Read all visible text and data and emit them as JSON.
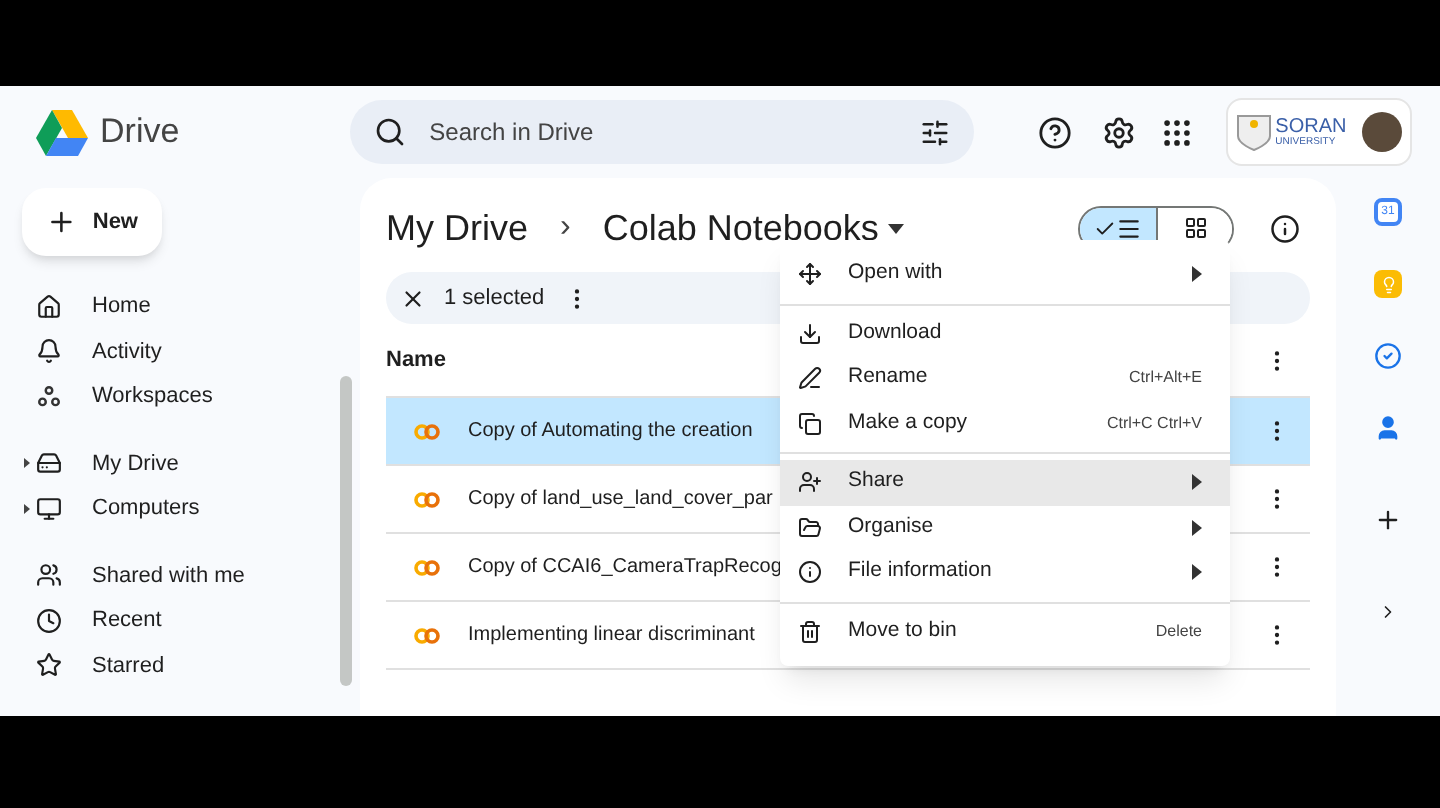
{
  "app": {
    "name": "Drive"
  },
  "search": {
    "placeholder": "Search in Drive"
  },
  "account": {
    "org_line1": "SORAN",
    "org_line2": "UNIVERSITY"
  },
  "new_button": {
    "label": "New"
  },
  "sidebar": {
    "items": [
      {
        "label": "Home",
        "expandable": false
      },
      {
        "label": "Activity",
        "expandable": false
      },
      {
        "label": "Workspaces",
        "expandable": false
      },
      {
        "label": "My Drive",
        "expandable": true
      },
      {
        "label": "Computers",
        "expandable": true
      },
      {
        "label": "Shared with me",
        "expandable": false
      },
      {
        "label": "Recent",
        "expandable": false
      },
      {
        "label": "Starred",
        "expandable": false
      }
    ]
  },
  "breadcrumb": {
    "root": "My Drive",
    "separator": "›",
    "current": "Colab Notebooks"
  },
  "view_toggle": {
    "list_selected": true
  },
  "selection_bar": {
    "count": "1 selected"
  },
  "table": {
    "columns": [
      "Name"
    ],
    "rows": [
      {
        "name": "Copy of Automating the creation",
        "selected": true
      },
      {
        "name": "Copy of land_use_land_cover_par",
        "selected": false
      },
      {
        "name": "Copy of CCAI6_CameraTrapRecog",
        "selected": false
      },
      {
        "name": "Implementing linear discriminant",
        "selected": false
      }
    ]
  },
  "context_menu": {
    "sections": [
      [
        {
          "label": "Open with",
          "submenu": true,
          "highlighted": false
        }
      ],
      [
        {
          "label": "Download",
          "submenu": false,
          "highlighted": false
        },
        {
          "label": "Rename",
          "shortcut": "Ctrl+Alt+E",
          "submenu": false,
          "highlighted": false
        },
        {
          "label": "Make a copy",
          "shortcut": "Ctrl+C Ctrl+V",
          "submenu": false,
          "highlighted": false
        }
      ],
      [
        {
          "label": "Share",
          "submenu": true,
          "highlighted": true
        },
        {
          "label": "Organise",
          "submenu": true,
          "highlighted": false
        },
        {
          "label": "File information",
          "submenu": true,
          "highlighted": false
        }
      ],
      [
        {
          "label": "Move to bin",
          "shortcut": "Delete",
          "submenu": false,
          "highlighted": false
        }
      ]
    ]
  },
  "right_rail": {
    "calendar_day": "31"
  }
}
